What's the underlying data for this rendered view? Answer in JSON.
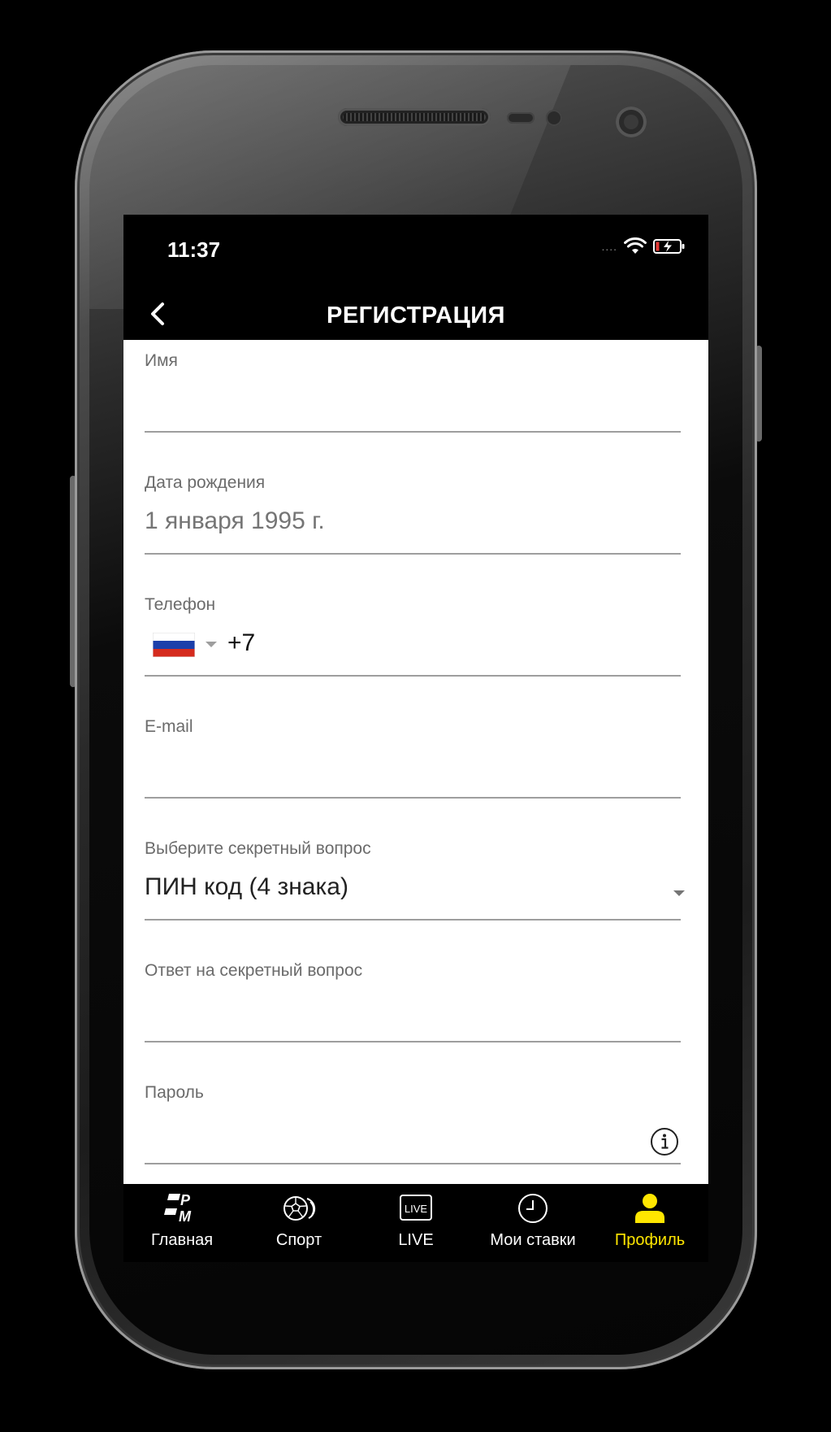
{
  "status_bar": {
    "time": "11:37",
    "signal": "....",
    "icons": [
      "wifi-icon",
      "battery-charging-icon"
    ]
  },
  "header": {
    "title": "РЕГИСТРАЦИЯ",
    "back_icon": "chevron-left-icon"
  },
  "form": {
    "name": {
      "label": "Имя",
      "value": ""
    },
    "birth_date": {
      "label": "Дата рождения",
      "value": "1 января 1995 г."
    },
    "phone": {
      "label": "Телефон",
      "country_flag": "russia-flag-icon",
      "prefix": "+7"
    },
    "email": {
      "label": "E-mail",
      "value": ""
    },
    "secret_question": {
      "label": "Выберите секретный вопрос",
      "selected": "ПИН код (4 знака)"
    },
    "secret_answer": {
      "label": "Ответ на секретный вопрос",
      "value": ""
    },
    "password": {
      "label": "Пароль",
      "value": "",
      "info_icon": "info-icon"
    }
  },
  "tab_bar": {
    "active_color": "#ffe600",
    "items": [
      {
        "label": "Главная",
        "icon": "pm-logo-icon"
      },
      {
        "label": "Спорт",
        "icon": "sports-balls-icon"
      },
      {
        "label": "LIVE",
        "icon": "live-badge-icon"
      },
      {
        "label": "Мои ставки",
        "icon": "clock-icon"
      },
      {
        "label": "Профиль",
        "icon": "profile-icon"
      }
    ]
  }
}
